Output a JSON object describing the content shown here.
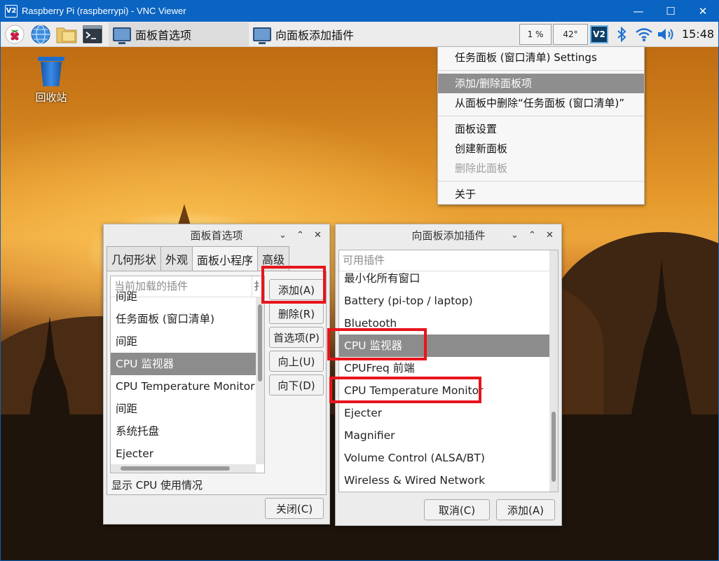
{
  "window": {
    "title": "Raspberry Pi (raspberrypi) - VNC Viewer",
    "logo": "V2",
    "minimize": "—",
    "maximize": "☐",
    "close": "✕"
  },
  "taskbar": {
    "tasks": [
      {
        "label": "面板首选项"
      },
      {
        "label": "向面板添加插件"
      }
    ],
    "cpu": "1 %",
    "temp": "42°",
    "vnc": "V2",
    "clock": "15:48"
  },
  "desktop": {
    "trash_label": "回收站"
  },
  "context_menu": {
    "items": [
      "任务面板 (窗口清单) Settings",
      "添加/删除面板项",
      "从面板中删除“任务面板 (窗口清单)”",
      "面板设置",
      "创建新面板",
      "删除此面板",
      "关于"
    ]
  },
  "prefs": {
    "title": "面板首选项",
    "tabs": [
      "几何形状",
      "外观",
      "面板小程序",
      "高级"
    ],
    "list_header": "当前加载的插件",
    "list_header_extra": "扌",
    "items": [
      "间距",
      "任务面板 (窗口清单)",
      "间距",
      "CPU 监视器",
      "CPU Temperature Monitor",
      "间距",
      "系统托盘",
      "Ejecter"
    ],
    "buttons": {
      "add": "添加(A)",
      "remove": "删除(R)",
      "prefs": "首选项(P)",
      "up": "向上(U)",
      "down": "向下(D)",
      "close": "关闭(C)"
    },
    "status": "显示 CPU 使用情况"
  },
  "add_plugin": {
    "title": "向面板添加插件",
    "list_header": "可用插件",
    "items": [
      "最小化所有窗口",
      "Battery (pi-top / laptop)",
      "Bluetooth",
      "CPU 监视器",
      "CPUFreq 前端",
      "CPU Temperature Monitor",
      "Ejecter",
      "Magnifier",
      "Volume Control (ALSA/BT)",
      "Wireless & Wired Network"
    ],
    "buttons": {
      "cancel": "取消(C)",
      "add": "添加(A)"
    }
  },
  "controls": {
    "chevron_down": "⌄",
    "chevron_up": "⌃",
    "close": "✕"
  },
  "colors": {
    "highlight": "#8c8c8c",
    "annotation": "#e8141c",
    "titlebar": "#0a64c2"
  }
}
